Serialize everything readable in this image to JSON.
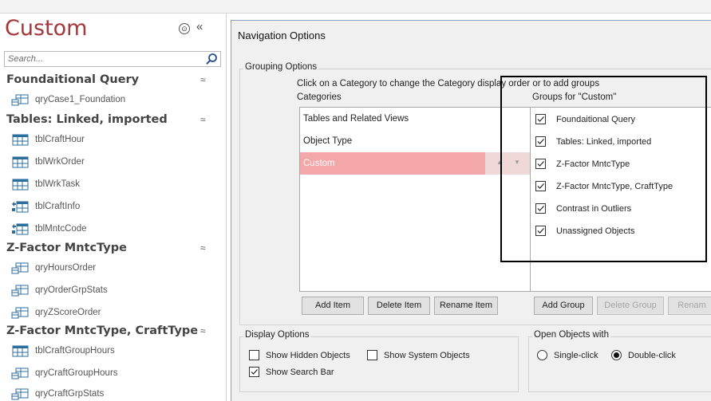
{
  "nav": {
    "title": "Custom",
    "menu_glyph": "⊙",
    "collapse_glyph": "«",
    "search_placeholder": "Search...",
    "groups": [
      {
        "title": "Foundaitional Query",
        "items": [
          {
            "label": "qryCase1_Foundation",
            "icon": "query-icon"
          }
        ]
      },
      {
        "title": "Tables: Linked, imported",
        "items": [
          {
            "label": "tblCraftHour",
            "icon": "table-icon"
          },
          {
            "label": "tblWrkOrder",
            "icon": "table-icon"
          },
          {
            "label": "tblWrkTask",
            "icon": "table-icon"
          },
          {
            "label": "tblCraftInfo",
            "icon": "linked-table-icon"
          },
          {
            "label": "tblMntcCode",
            "icon": "linked-table-icon"
          }
        ]
      },
      {
        "title": "Z-Factor MntcType",
        "items": [
          {
            "label": "qryHoursOrder",
            "icon": "query-icon"
          },
          {
            "label": "qryOrderGrpStats",
            "icon": "query-icon"
          },
          {
            "label": "qryZScoreOrder",
            "icon": "query-icon"
          }
        ]
      },
      {
        "title": "Z-Factor MntcType, CraftType",
        "items": [
          {
            "label": "tblCraftGroupHours",
            "icon": "table-icon"
          },
          {
            "label": "qryCraftGroupHours",
            "icon": "query-icon"
          },
          {
            "label": "qryCraftGrpStats",
            "icon": "query-icon"
          }
        ]
      }
    ],
    "group_chevron": "≈"
  },
  "dialog": {
    "title": "Navigation Options",
    "grouping_legend": "Grouping Options",
    "instructions": "Click on a Category to change the Category display order or to add groups",
    "categories_header": "Categories",
    "groups_header": "Groups for \"Custom\"",
    "categories": [
      {
        "label": "Tables and Related Views",
        "selected": false
      },
      {
        "label": "Object Type",
        "selected": false
      },
      {
        "label": "Custom",
        "selected": true
      }
    ],
    "groups": [
      {
        "label": "Foundaitional Query",
        "checked": true
      },
      {
        "label": "Tables: Linked, imported",
        "checked": true
      },
      {
        "label": "Z-Factor MntcType",
        "checked": true
      },
      {
        "label": "Z-Factor MntcType, CraftType",
        "checked": true
      },
      {
        "label": "Contrast in Outliers",
        "checked": true
      },
      {
        "label": "Unassigned Objects",
        "checked": true
      }
    ],
    "buttons": {
      "add_item": "Add Item",
      "delete_item": "Delete Item",
      "rename_item": "Rename Item",
      "add_group": "Add Group",
      "delete_group": "Delete Group",
      "rename_group": "Renam"
    },
    "display_legend": "Display Options",
    "show_hidden": {
      "label": "Show Hidden Objects",
      "checked": false
    },
    "show_system": {
      "label": "Show System Objects",
      "checked": false
    },
    "show_search": {
      "label": "Show Search Bar",
      "checked": true
    },
    "open_legend": "Open Objects with",
    "single_click": {
      "label": "Single-click",
      "selected": false
    },
    "double_click": {
      "label": "Double-click",
      "selected": true
    }
  },
  "colors": {
    "title_red": "#a4373a",
    "selection_pink": "#f4a7a8"
  }
}
